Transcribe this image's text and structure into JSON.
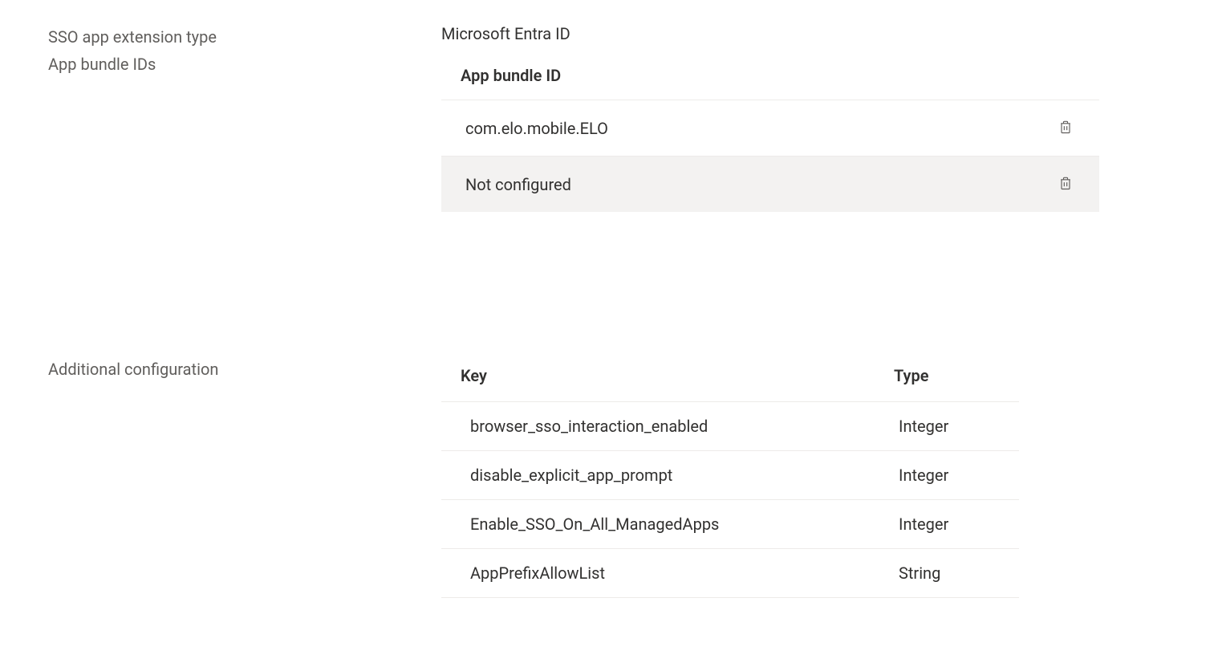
{
  "sso": {
    "extension_type_label": "SSO app extension type",
    "extension_type_value": "Microsoft Entra ID"
  },
  "bundle_ids": {
    "label": "App bundle IDs",
    "header": "App bundle ID",
    "rows": [
      {
        "value": "com.elo.mobile.ELO"
      },
      {
        "value": "Not configured"
      }
    ]
  },
  "additional_config": {
    "label": "Additional configuration",
    "headers": {
      "key": "Key",
      "type": "Type"
    },
    "rows": [
      {
        "key": "browser_sso_interaction_enabled",
        "type": "Integer"
      },
      {
        "key": "disable_explicit_app_prompt",
        "type": "Integer"
      },
      {
        "key": "Enable_SSO_On_All_ManagedApps",
        "type": "Integer"
      },
      {
        "key": "AppPrefixAllowList",
        "type": "String"
      }
    ]
  }
}
